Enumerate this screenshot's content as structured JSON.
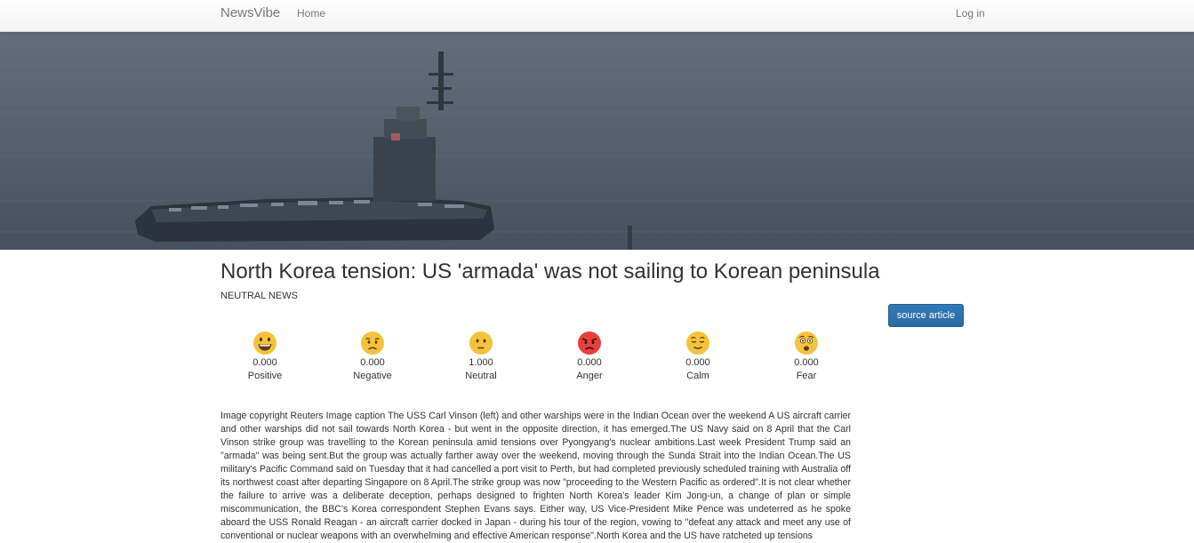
{
  "navbar": {
    "brand": "NewsVibe",
    "home_label": "Home",
    "login_label": "Log in"
  },
  "article": {
    "title": "North Korea tension: US 'armada' was not sailing to Korean peninsula",
    "category": "NEUTRAL NEWS",
    "source_button_label": "source article",
    "body": "Image copyright Reuters Image caption The USS Carl Vinson (left) and other warships were in the Indian Ocean over the weekend A US aircraft carrier and other warships did not sail towards North Korea - but went in the opposite direction, it has emerged.The US Navy said on 8 April that the Carl Vinson strike group was travelling to the Korean peninsula amid tensions over Pyongyang's nuclear ambitions.Last week President Trump said an \"armada\" was being sent.But the group was actually farther away over the weekend, moving through the Sunda Strait into the Indian Ocean.The US military's Pacific Command said on Tuesday that it had cancelled a port visit to Perth, but had completed previously scheduled training with Australia off its northwest coast after departing Singapore on 8 April.The strike group was now \"proceeding to the Western Pacific as ordered\".It is not clear whether the failure to arrive was a deliberate deception, perhaps designed to frighten North Korea's leader Kim Jong-un, a change of plan or simple miscommunication, the BBC's Korea correspondent Stephen Evans says. Either way, US Vice-President Mike Pence was undeterred as he spoke aboard the USS Ronald Reagan - an aircraft carrier docked in Japan - during his tour of the region, vowing to \"defeat any attack and meet any use of conventional or nuclear weapons with an overwhelming and effective American response\".North Korea and the US have ratcheted up tensions"
  },
  "emotions": [
    {
      "label": "Positive",
      "score": "0.000",
      "icon": "grinning-face-icon",
      "color": "#f5c33b"
    },
    {
      "label": "Negative",
      "score": "0.000",
      "icon": "sad-face-icon",
      "color": "#f5c33b"
    },
    {
      "label": "Neutral",
      "score": "1.000",
      "icon": "neutral-face-icon",
      "color": "#f5c33b"
    },
    {
      "label": "Anger",
      "score": "0.000",
      "icon": "angry-face-icon",
      "color": "#e8413c"
    },
    {
      "label": "Calm",
      "score": "0.000",
      "icon": "relieved-face-icon",
      "color": "#f5c33b"
    },
    {
      "label": "Fear",
      "score": "0.000",
      "icon": "fearful-face-icon",
      "color": "#f5c33b"
    }
  ],
  "colors": {
    "primary_button": "#337ab7",
    "navbar_text": "#777777",
    "text": "#333333"
  }
}
